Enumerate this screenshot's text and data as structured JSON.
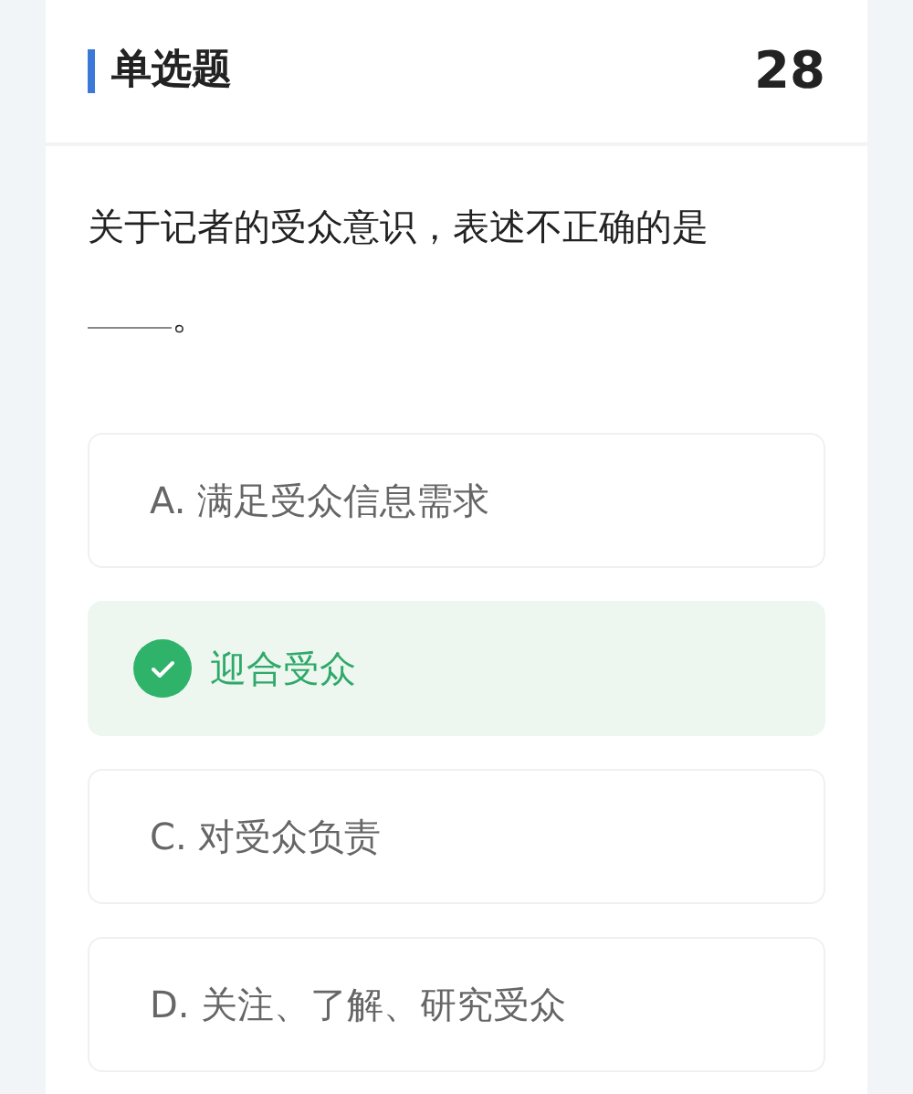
{
  "header": {
    "title": "单选题",
    "number": "28"
  },
  "question": {
    "text": "关于记者的受众意识，表述不正确的是",
    "end": "。"
  },
  "options": [
    {
      "text": "A. 满足受众信息需求",
      "selected": false
    },
    {
      "text": "迎合受众",
      "selected": true
    },
    {
      "text": "C. 对受众负责",
      "selected": false
    },
    {
      "text": "D. 关注、了解、研究受众",
      "selected": false
    }
  ]
}
